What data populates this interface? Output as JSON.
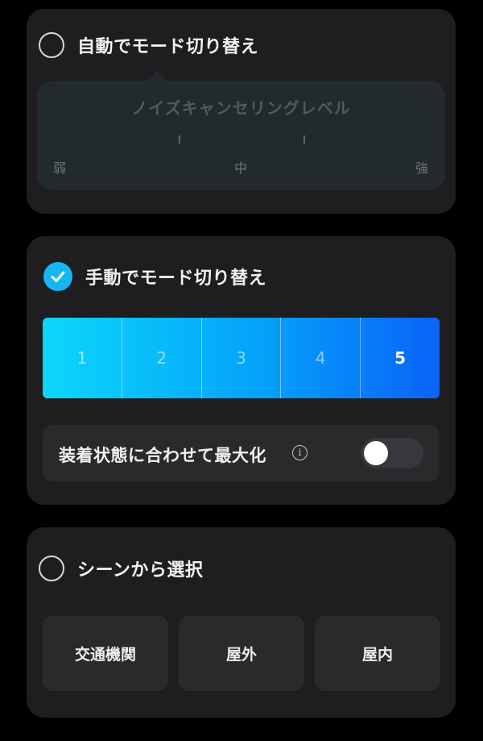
{
  "auto_mode": {
    "label": "自動でモード切り替え",
    "selected": false,
    "level_panel": {
      "title": "ノイズキャンセリングレベル",
      "labels": {
        "low": "弱",
        "mid": "中",
        "high": "強"
      }
    }
  },
  "manual_mode": {
    "label": "手動でモード切り替え",
    "selected": true,
    "levels": [
      "1",
      "2",
      "3",
      "4",
      "5"
    ],
    "selected_level": "5",
    "maximize": {
      "label": "装着状態に合わせて最大化",
      "info_glyph": "i",
      "toggle_on": false
    }
  },
  "scene_mode": {
    "label": "シーンから選択",
    "selected": false,
    "scenes": [
      "交通機関",
      "屋外",
      "屋内"
    ]
  },
  "colors": {
    "accent": "#13b8f3",
    "gradient_start": "#0cd7fb",
    "gradient_end": "#0a63f8",
    "card_bg": "#1e1e21"
  }
}
